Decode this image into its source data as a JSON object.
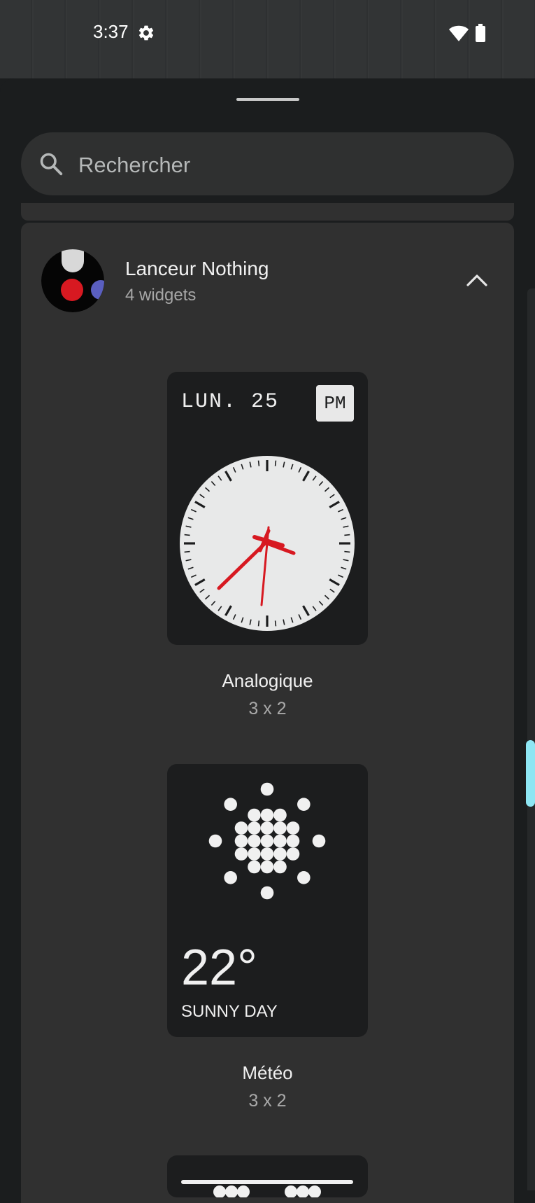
{
  "status_bar": {
    "time": "3:37",
    "icons": [
      "gear-icon",
      "wifi-icon",
      "battery-icon"
    ]
  },
  "search": {
    "placeholder": "Rechercher",
    "icon": "search-icon"
  },
  "app_group": {
    "name": "Lanceur Nothing",
    "widget_count": "4 widgets",
    "expanded": true
  },
  "widgets": [
    {
      "name": "Analogique",
      "size": "3 x 2",
      "preview": {
        "date": "LUN. 25",
        "ampm": "PM"
      }
    },
    {
      "name": "Météo",
      "size": "3 x 2",
      "preview": {
        "temperature": "22°",
        "condition": "SUNNY DAY"
      }
    }
  ],
  "colors": {
    "background": "#1b1d1e",
    "card": "#303030",
    "widget": "#1c1d1e",
    "accent_red": "#d71921",
    "scroll_thumb": "#8ee6f3"
  }
}
